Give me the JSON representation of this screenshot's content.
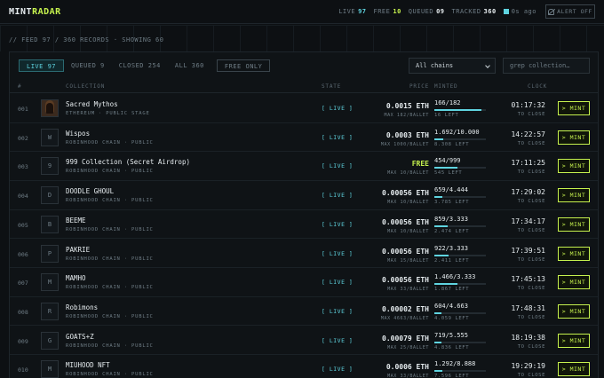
{
  "header": {
    "logo_a": "MINT",
    "logo_b": "RADAR",
    "stats": [
      {
        "label": "LIVE",
        "value": "97",
        "color": "cyan"
      },
      {
        "label": "FREE",
        "value": "10",
        "color": "green"
      },
      {
        "label": "QUEUED",
        "value": "09",
        "color": "white"
      },
      {
        "label": "TRACKED",
        "value": "360",
        "color": "white"
      }
    ],
    "ago": "0s ago",
    "alert_label": "ALERT OFF"
  },
  "feed": {
    "line": "// FEED  97 / 360 RECORDS · SHOWING 60"
  },
  "filters": {
    "tabs": [
      {
        "label": "LIVE 97",
        "active": true
      },
      {
        "label": "QUEUED 9",
        "active": false
      },
      {
        "label": "CLOSED 254",
        "active": false
      },
      {
        "label": "ALL 360",
        "active": false
      }
    ],
    "free_only": "FREE ONLY",
    "chain_select": "All chains",
    "search_placeholder": "grep collection…"
  },
  "columns": {
    "idx": "#",
    "collection": "COLLECTION",
    "state": "STATE",
    "price": "PRICE",
    "minted": "MINTED",
    "clock": "CLOCK"
  },
  "rows": [
    {
      "idx": "001",
      "thumb": "",
      "image": true,
      "name": "Sacred Mythos",
      "sub": "ETHEREUM · PUBLIC STAGE",
      "state": "[ LIVE ]",
      "price": "0.0015 ETH",
      "free": false,
      "ballet": "MAX 182/BALLET",
      "minted": "166/182",
      "progress": 0.91,
      "left": "16 LEFT",
      "clock": "01:17:32",
      "to_close": "TO CLOSE",
      "mint": "> MINT"
    },
    {
      "idx": "002",
      "thumb": "W",
      "image": false,
      "name": "Wispos",
      "sub": "ROBINHOOD CHAIN · PUBLIC",
      "state": "[ LIVE ]",
      "price": "0.0003 ETH",
      "free": false,
      "ballet": "MAX 1000/BALLET",
      "minted": "1.692/10.000",
      "progress": 0.17,
      "left": "8.308 LEFT",
      "clock": "14:22:57",
      "to_close": "TO CLOSE",
      "mint": "> MINT"
    },
    {
      "idx": "003",
      "thumb": "9",
      "image": false,
      "name": "999 Collection (Secret Airdrop)",
      "sub": "ROBINHOOD CHAIN · PUBLIC",
      "state": "[ LIVE ]",
      "price": "FREE",
      "free": true,
      "ballet": "MAX 10/BALLET",
      "minted": "454/999",
      "progress": 0.45,
      "left": "545 LEFT",
      "clock": "17:11:25",
      "to_close": "TO CLOSE",
      "mint": "> MINT"
    },
    {
      "idx": "004",
      "thumb": "D",
      "image": false,
      "name": "DOODLE GHOUL",
      "sub": "ROBINHOOD CHAIN · PUBLIC",
      "state": "[ LIVE ]",
      "price": "0.00056 ETH",
      "free": false,
      "ballet": "MAX 10/BALLET",
      "minted": "659/4.444",
      "progress": 0.15,
      "left": "3.785 LEFT",
      "clock": "17:29:02",
      "to_close": "TO CLOSE",
      "mint": "> MINT"
    },
    {
      "idx": "005",
      "thumb": "B",
      "image": false,
      "name": "BEEME",
      "sub": "ROBINHOOD CHAIN · PUBLIC",
      "state": "[ LIVE ]",
      "price": "0.00056 ETH",
      "free": false,
      "ballet": "MAX 10/BALLET",
      "minted": "859/3.333",
      "progress": 0.26,
      "left": "2.474 LEFT",
      "clock": "17:34:17",
      "to_close": "TO CLOSE",
      "mint": "> MINT"
    },
    {
      "idx": "006",
      "thumb": "P",
      "image": false,
      "name": "PAKRIE",
      "sub": "ROBINHOOD CHAIN · PUBLIC",
      "state": "[ LIVE ]",
      "price": "0.00056 ETH",
      "free": false,
      "ballet": "MAX 15/BALLET",
      "minted": "922/3.333",
      "progress": 0.28,
      "left": "2.411 LEFT",
      "clock": "17:39:51",
      "to_close": "TO CLOSE",
      "mint": "> MINT"
    },
    {
      "idx": "007",
      "thumb": "M",
      "image": false,
      "name": "MAMHO",
      "sub": "ROBINHOOD CHAIN · PUBLIC",
      "state": "[ LIVE ]",
      "price": "0.00056 ETH",
      "free": false,
      "ballet": "MAX 33/BALLET",
      "minted": "1.466/3.333",
      "progress": 0.44,
      "left": "1.867 LEFT",
      "clock": "17:45:13",
      "to_close": "TO CLOSE",
      "mint": "> MINT"
    },
    {
      "idx": "008",
      "thumb": "R",
      "image": false,
      "name": "Robimons",
      "sub": "ROBINHOOD CHAIN · PUBLIC",
      "state": "[ LIVE ]",
      "price": "0.00002 ETH",
      "free": false,
      "ballet": "MAX 4663/BALLET",
      "minted": "604/4.663",
      "progress": 0.13,
      "left": "4.059 LEFT",
      "clock": "17:48:31",
      "to_close": "TO CLOSE",
      "mint": "> MINT"
    },
    {
      "idx": "009",
      "thumb": "G",
      "image": false,
      "name": "GOATS+Z",
      "sub": "ROBINHOOD CHAIN · PUBLIC",
      "state": "[ LIVE ]",
      "price": "0.00079 ETH",
      "free": false,
      "ballet": "MAX 25/BALLET",
      "minted": "719/5.555",
      "progress": 0.13,
      "left": "4.836 LEFT",
      "clock": "18:19:38",
      "to_close": "TO CLOSE",
      "mint": "> MINT"
    },
    {
      "idx": "010",
      "thumb": "M",
      "image": false,
      "name": "MIUHOOD NFT",
      "sub": "ROBINHOOD CHAIN · PUBLIC",
      "state": "[ LIVE ]",
      "price": "0.0006 ETH",
      "free": false,
      "ballet": "MAX 33/BALLET",
      "minted": "1.292/8.888",
      "progress": 0.15,
      "left": "7.596 LEFT",
      "clock": "19:29:19",
      "to_close": "TO CLOSE",
      "mint": "> MINT"
    }
  ]
}
